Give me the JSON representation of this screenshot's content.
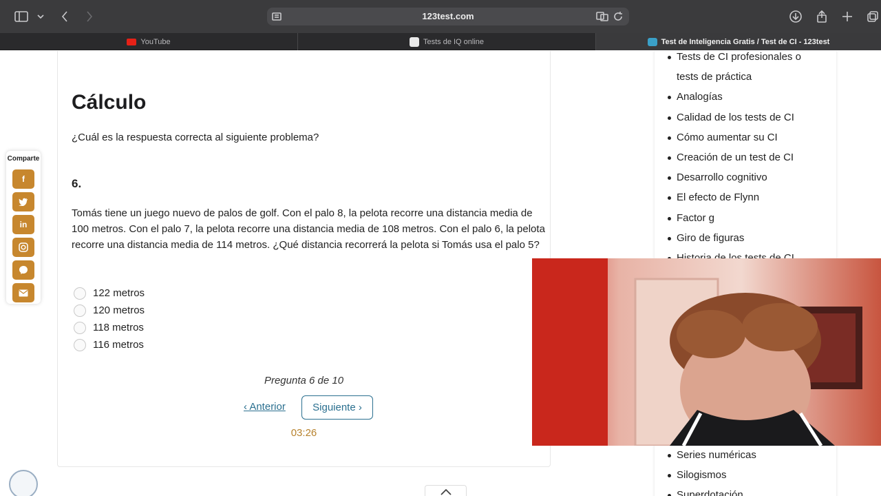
{
  "browser": {
    "url": "123test.com",
    "tabs": [
      {
        "label": "YouTube",
        "active": false
      },
      {
        "label": "Tests de IQ online",
        "active": false
      },
      {
        "label": "Test de Inteligencia Gratis / Test de CI - 123test",
        "active": true
      }
    ]
  },
  "quiz": {
    "section_title": "Cálculo",
    "prompt": "¿Cuál es la respuesta correcta al siguiente problema?",
    "question_number": "6.",
    "problem_text": "Tomás tiene un juego nuevo de palos de golf. Con el palo 8, la pelota recorre una distancia media de 100 metros. Con el palo 7, la pelota recorre una distancia media de 108 metros. Con el palo 6, la pelota recorre una distancia media de 114 metros. ¿Qué distancia recorrerá la pelota si Tomás usa el palo 5?",
    "options": [
      "122 metros",
      "120 metros",
      "118 metros",
      "116 metros"
    ],
    "progress": "Pregunta 6 de 10",
    "prev_label": "‹ Anterior",
    "next_label": "Siguiente ›",
    "timer": "03:26"
  },
  "share": {
    "label": "Comparte",
    "icons": [
      "facebook-icon",
      "twitter-icon",
      "linkedin-icon",
      "instagram-icon",
      "messenger-icon",
      "email-icon"
    ]
  },
  "sidebar": {
    "items": [
      {
        "label": "Tests de CI profesionales o",
        "continued": false
      },
      {
        "label": "tests de práctica",
        "continued": true
      },
      {
        "label": "Analogías",
        "continued": false
      },
      {
        "label": "Calidad de los tests de CI",
        "continued": false
      },
      {
        "label": "Cómo aumentar su CI",
        "continued": false
      },
      {
        "label": "Creación de un test de CI",
        "continued": false
      },
      {
        "label": "Desarrollo cognitivo",
        "continued": false
      },
      {
        "label": "El efecto de Flynn",
        "continued": false
      },
      {
        "label": "Factor g",
        "continued": false
      },
      {
        "label": "Giro de figuras",
        "continued": false
      },
      {
        "label": "Historia de los tests de CI",
        "continued": false
      }
    ],
    "bottom_items": [
      "Series numéricas",
      "Silogismos",
      "Superdotación"
    ]
  },
  "colors": {
    "accent": "#2a6f8f",
    "share_button": "#c7872e",
    "timer": "#b7822d"
  }
}
